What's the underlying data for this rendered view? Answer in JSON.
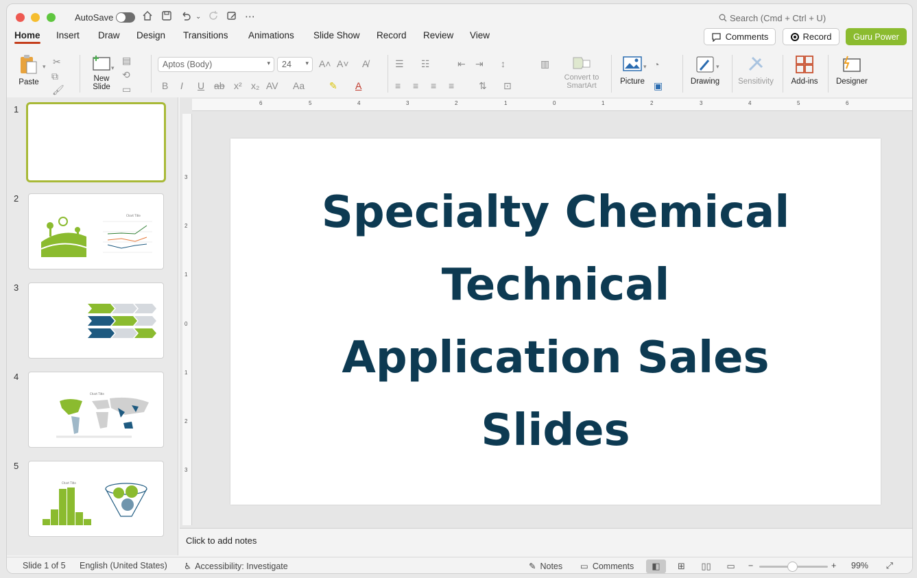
{
  "titlebar": {
    "autosave_label": "AutoSave",
    "search_placeholder": "Search (Cmd + Ctrl + U)"
  },
  "tabs": [
    {
      "label": "Home"
    },
    {
      "label": "Insert"
    },
    {
      "label": "Draw"
    },
    {
      "label": "Design"
    },
    {
      "label": "Transitions"
    },
    {
      "label": "Animations"
    },
    {
      "label": "Slide Show"
    },
    {
      "label": "Record"
    },
    {
      "label": "Review"
    },
    {
      "label": "View"
    }
  ],
  "header_buttons": {
    "comments": "Comments",
    "record": "Record",
    "guru": "Guru Power"
  },
  "ribbon": {
    "paste": "Paste",
    "new_slide_line1": "New",
    "new_slide_line2": "Slide",
    "font_name": "Aptos (Body)",
    "font_size": "24",
    "convert_line1": "Convert to",
    "convert_line2": "SmartArt",
    "picture": "Picture",
    "drawing": "Drawing",
    "sensitivity": "Sensitivity",
    "addins": "Add-ins",
    "designer": "Designer"
  },
  "slides": [
    {
      "num": "1"
    },
    {
      "num": "2",
      "chart_title": "Chart Title"
    },
    {
      "num": "3"
    },
    {
      "num": "4",
      "chart_title": "Chart Title"
    },
    {
      "num": "5",
      "chart_title": "Chart Title"
    }
  ],
  "main_slide": {
    "title": "Specialty Chemical Technical Application Sales Slides"
  },
  "ruler_h": [
    "6",
    "5",
    "4",
    "3",
    "2",
    "1",
    "0",
    "1",
    "2",
    "3",
    "4",
    "5",
    "6"
  ],
  "ruler_v": [
    "3",
    "2",
    "1",
    "0",
    "1",
    "2",
    "3"
  ],
  "notes_placeholder": "Click to add notes",
  "status": {
    "slide_info": "Slide 1 of 5",
    "language": "English (United States)",
    "accessibility": "Accessibility: Investigate",
    "notes": "Notes",
    "comments": "Comments",
    "zoom": "99%"
  },
  "colors": {
    "accent_green": "#8bbb2f",
    "title_navy": "#0d3a52",
    "tab_underline": "#c43e1c"
  }
}
